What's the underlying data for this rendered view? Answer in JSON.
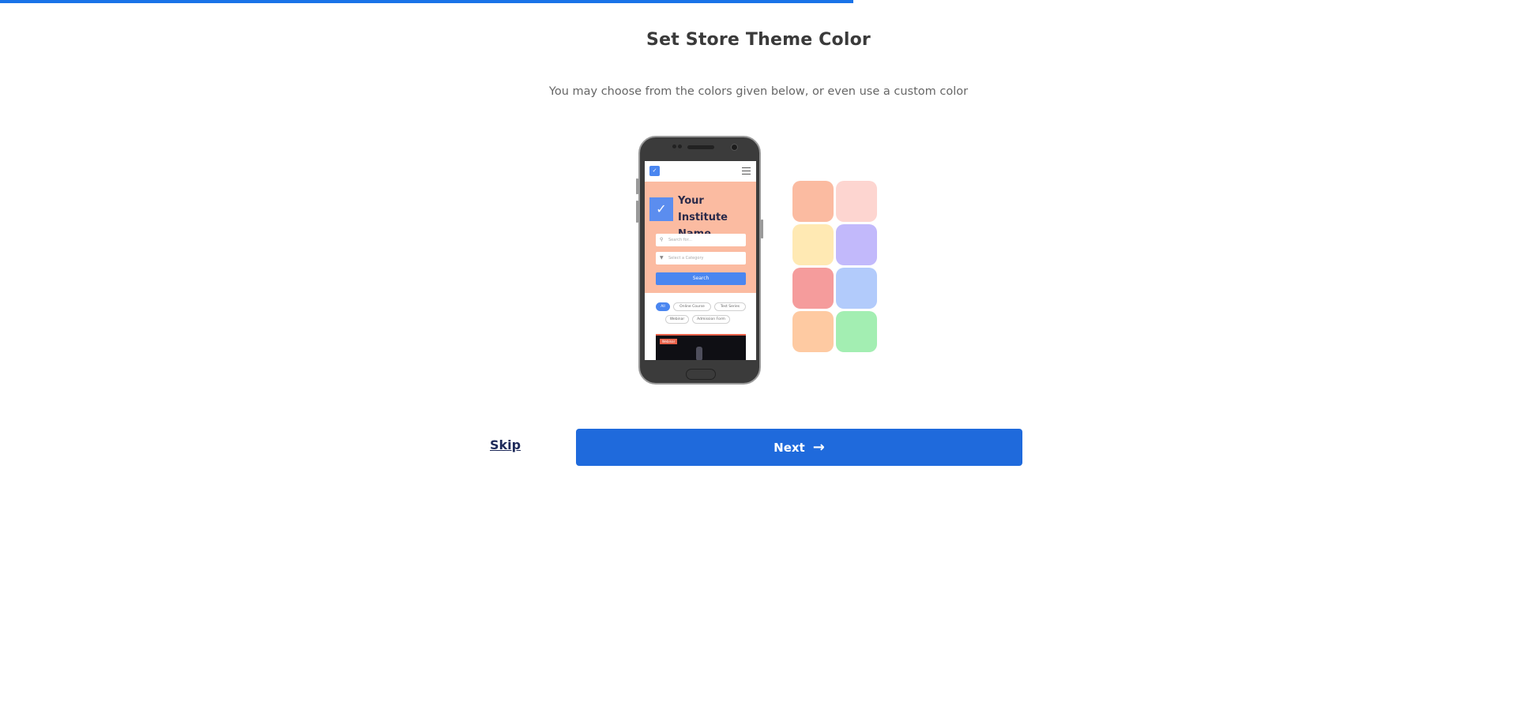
{
  "progress": {
    "fraction": 0.5625,
    "color": "#1a73e8"
  },
  "page": {
    "title": "Set Store Theme Color",
    "subtitle": "You may choose from the colors given below, or even use a custom color"
  },
  "preview": {
    "institute_name": "Your Institute Name",
    "search_placeholder": "Search for...",
    "category_placeholder": "Select a Category",
    "search_button": "Search",
    "chips": [
      "All",
      "Online Course",
      "Test Series",
      "Webinar",
      "Admission Form"
    ],
    "banner_tag": "Webinar",
    "accent_color": "#fbbba1"
  },
  "swatches": [
    {
      "name": "swatch-peach",
      "color": "#fbbba1"
    },
    {
      "name": "swatch-light-pink",
      "color": "#fdd5d0"
    },
    {
      "name": "swatch-cream",
      "color": "#ffe9b3"
    },
    {
      "name": "swatch-lavender",
      "color": "#c2b9fb"
    },
    {
      "name": "swatch-coral",
      "color": "#f59c9c"
    },
    {
      "name": "swatch-light-blue",
      "color": "#b2cbfb"
    },
    {
      "name": "swatch-apricot",
      "color": "#fecaa2"
    },
    {
      "name": "swatch-mint",
      "color": "#a3eeb2"
    }
  ],
  "actions": {
    "skip_label": "Skip",
    "next_label": "Next",
    "next_icon": "arrow-right-icon"
  }
}
